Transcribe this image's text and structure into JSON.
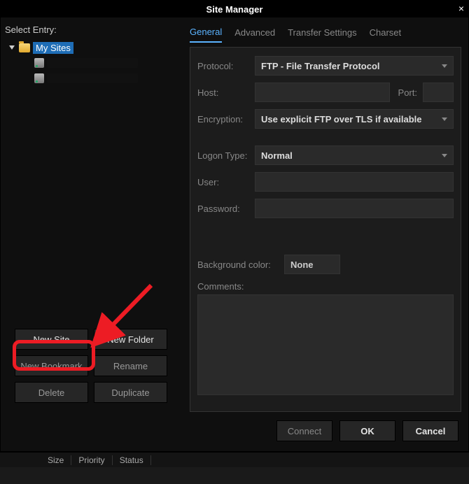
{
  "titlebar": {
    "title": "Site Manager",
    "close": "×"
  },
  "left": {
    "select_label": "Select Entry:",
    "root_label": "My Sites",
    "buttons": {
      "new_site": "New Site",
      "new_folder": "New Folder",
      "new_bookmark": "New Bookmark",
      "rename": "Rename",
      "delete": "Delete",
      "duplicate": "Duplicate"
    }
  },
  "tabs": {
    "general": "General",
    "advanced": "Advanced",
    "transfer": "Transfer Settings",
    "charset": "Charset"
  },
  "form": {
    "protocol_label": "Protocol:",
    "protocol_value": "FTP - File Transfer Protocol",
    "host_label": "Host:",
    "port_label": "Port:",
    "encryption_label": "Encryption:",
    "encryption_value": "Use explicit FTP over TLS if available",
    "logon_label": "Logon Type:",
    "logon_value": "Normal",
    "user_label": "User:",
    "password_label": "Password:",
    "bgcolor_label": "Background color:",
    "bgcolor_value": "None",
    "comments_label": "Comments:"
  },
  "dialog_buttons": {
    "connect": "Connect",
    "ok": "OK",
    "cancel": "Cancel"
  },
  "statusbar": {
    "size": "Size",
    "priority": "Priority",
    "status": "Status"
  }
}
